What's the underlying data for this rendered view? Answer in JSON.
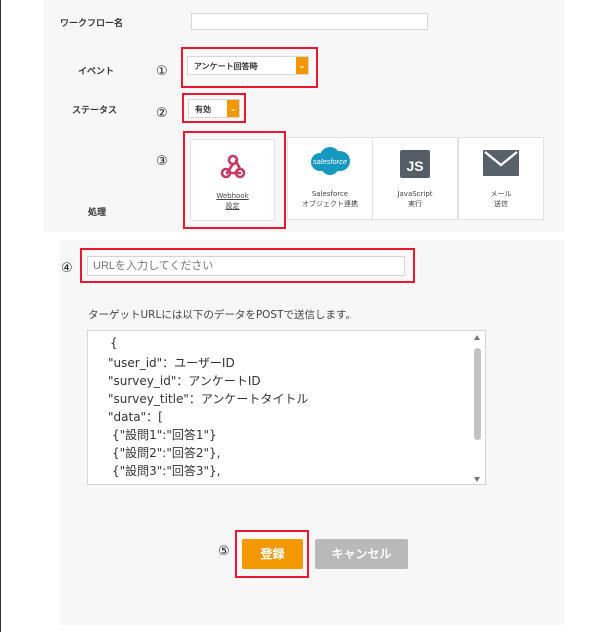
{
  "form": {
    "workflow_name_label": "ワークフロー名",
    "event_label": "イベント",
    "status_label": "ステータス",
    "process_label": "処理",
    "event_value": "アンケート回答時",
    "status_value": "有効",
    "workflow_name_value": ""
  },
  "steps": {
    "one": "①",
    "two": "②",
    "three": "③",
    "four": "④",
    "five": "⑤"
  },
  "processes": [
    {
      "line1": "Webhook",
      "line2": "設定",
      "icon": "webhook-icon"
    },
    {
      "line1": "Salesforce",
      "line2": "オブジェクト連携",
      "icon": "salesforce-icon",
      "logo_text": "salesforce"
    },
    {
      "line1": "JavaScript",
      "line2": "実行",
      "icon": "javascript-icon",
      "logo_text": "JS"
    },
    {
      "line1": "メール",
      "line2": "送信",
      "icon": "mail-icon"
    }
  ],
  "webhook": {
    "url_placeholder": "URLを入力してください",
    "info_text": "ターゲットURLには以下のデータをPOSTで送信します。",
    "code_lines": [
      "{",
      "\"user_id\"：ユーザーID",
      "\"survey_id\"：アンケートID",
      "\"survey_title\"：アンケートタイトル",
      "\"data\"：[",
      " {\"設問1\":\"回答1\"}",
      " {\"設問2\":\"回答2\"},",
      " {\"設問3\":\"回答3\"},"
    ]
  },
  "buttons": {
    "register": "登録",
    "cancel": "キャンセル"
  },
  "colors": {
    "accent_orange": "#f39800",
    "highlight_red": "#e8192c",
    "cancel_gray": "#b9b9b9",
    "webhook_magenta": "#c73a63",
    "salesforce_blue": "#1798c1",
    "js_gray": "#555e66",
    "mail_gray": "#58616a"
  }
}
